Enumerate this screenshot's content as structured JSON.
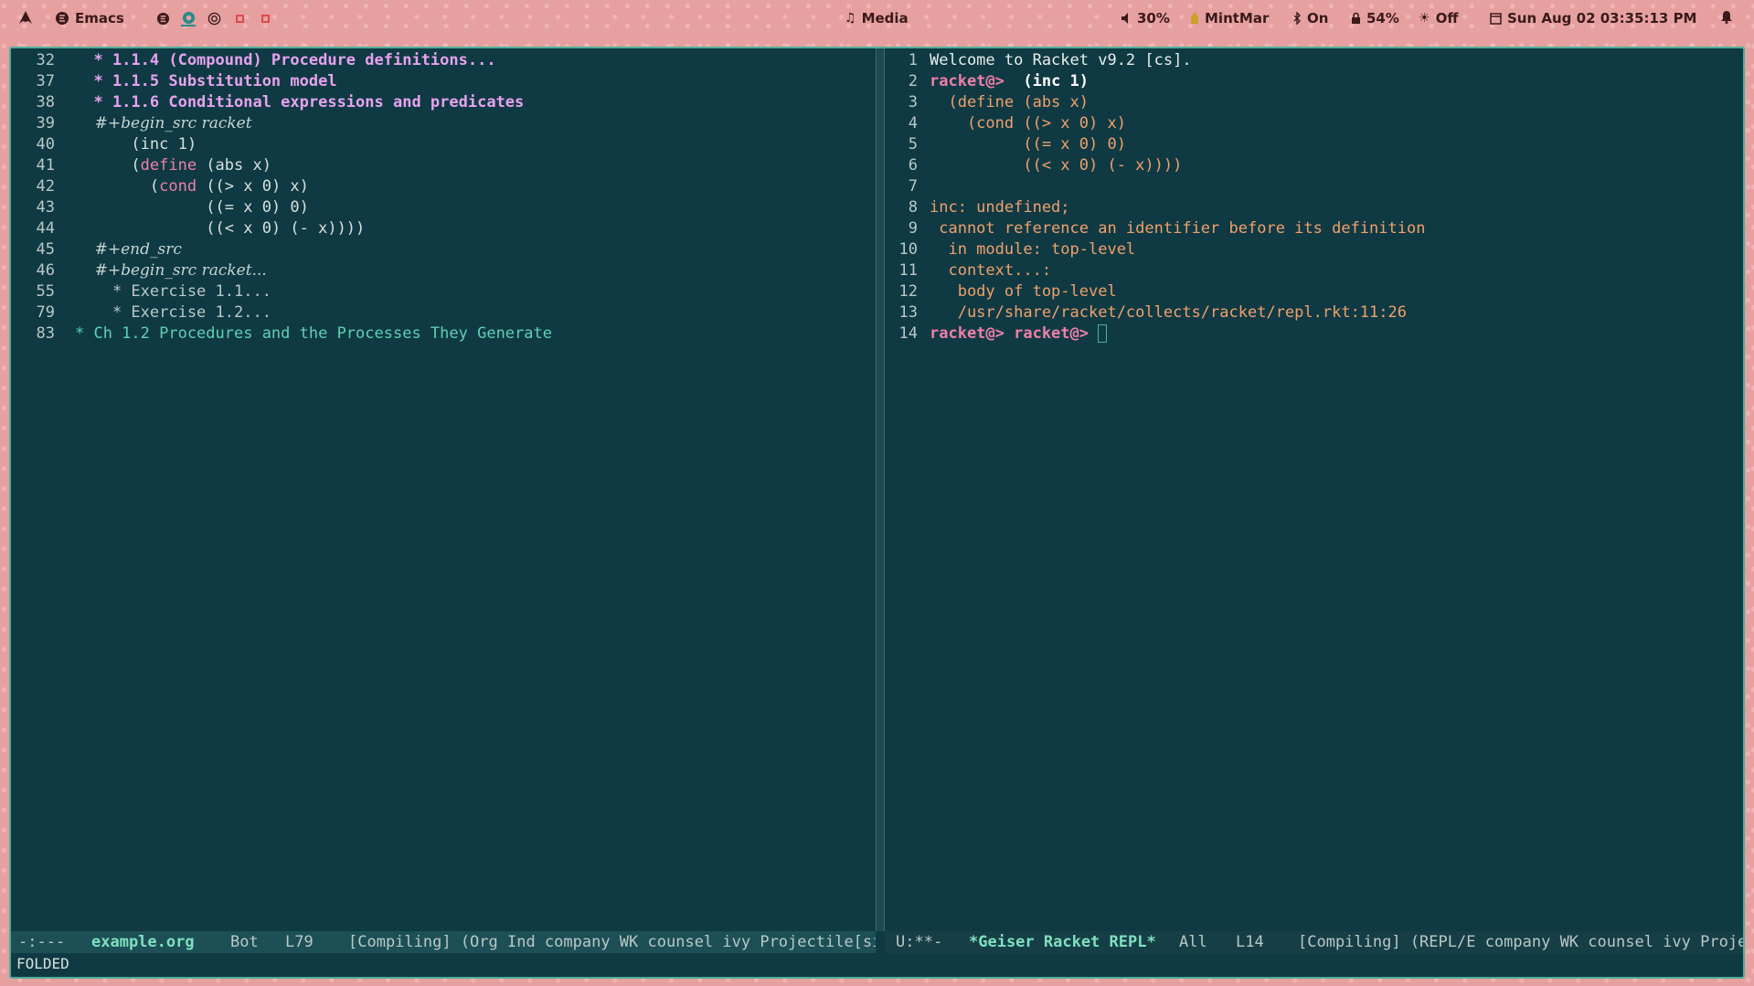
{
  "topbar": {
    "launcher_icon": "arch-icon",
    "app_icon": "emacs-icon",
    "app_label": "Emacs",
    "workspaces": [
      "emacs-ws-icon",
      "browser-ws-icon",
      "target-ws-icon",
      "empty-ws-icon",
      "empty-ws-icon"
    ],
    "media_label": "Media",
    "volume": "30%",
    "keyboard": "MintMar",
    "bluetooth": "On",
    "battery": "54%",
    "brightness": "Off",
    "datetime": "Sun Aug 02 03:35:13 PM"
  },
  "left_pane": {
    "lines": [
      {
        "num": "32",
        "text": "  * 1.1.4 (Compound) Procedure definitions...",
        "kind": "head"
      },
      {
        "num": "37",
        "text": "  * 1.1.5 Substitution model",
        "kind": "head"
      },
      {
        "num": "38",
        "text": "  * 1.1.6 Conditional expressions and predicates",
        "kind": "head"
      },
      {
        "num": "39",
        "text": "    #+begin_src racket",
        "kind": "meta"
      },
      {
        "num": "40",
        "text": "      (inc 1)",
        "kind": "code"
      },
      {
        "num": "41",
        "text": "      (define (abs x)",
        "kind": "define"
      },
      {
        "num": "42",
        "text": "        (cond ((> x 0) x)",
        "kind": "cond"
      },
      {
        "num": "43",
        "text": "              ((= x 0) 0)",
        "kind": "code"
      },
      {
        "num": "44",
        "text": "              ((< x 0) (- x))))",
        "kind": "code"
      },
      {
        "num": "45",
        "text": "    #+end_src",
        "kind": "meta"
      },
      {
        "num": "46",
        "text": "    #+begin_src racket...",
        "kind": "meta"
      },
      {
        "num": "55",
        "text": "    * Exercise 1.1...",
        "kind": "ex"
      },
      {
        "num": "79",
        "text": "    * Exercise 1.2...",
        "kind": "ex"
      },
      {
        "num": "83",
        "text": "* Ch 1.2 Procedures and the Processes They Generate",
        "kind": "ch"
      }
    ]
  },
  "right_pane": {
    "lines": [
      {
        "num": "1",
        "text": "Welcome to Racket v9.2 [cs]."
      },
      {
        "num": "2",
        "prompt": "racket@>",
        "text": "  (inc 1)"
      },
      {
        "num": "3",
        "text": "  (define (abs x)"
      },
      {
        "num": "4",
        "text": "    (cond ((> x 0) x)"
      },
      {
        "num": "5",
        "text": "          ((= x 0) 0)"
      },
      {
        "num": "6",
        "text": "          ((< x 0) (- x))))"
      },
      {
        "num": "7",
        "text": ""
      },
      {
        "num": "8",
        "text": "inc: undefined;"
      },
      {
        "num": "9",
        "text": " cannot reference an identifier before its definition"
      },
      {
        "num": "10",
        "text": "  in module: top-level"
      },
      {
        "num": "11",
        "text": "  context...:"
      },
      {
        "num": "12",
        "text": "   body of top-level"
      },
      {
        "num": "13",
        "text": "   /usr/share/racket/collects/racket/repl.rkt:11:26"
      },
      {
        "num": "14",
        "prompt": "racket@> racket@>",
        "text": ""
      }
    ]
  },
  "modeline_left": {
    "state": "-:---",
    "buffer": "example.org",
    "position": "Bot",
    "line": "L79",
    "modes": "[Compiling] (Org Ind company WK counsel ivy Projectile[sic"
  },
  "modeline_right": {
    "state": "U:**-",
    "buffer": "*Geiser Racket REPL*",
    "position": "All",
    "line": "L14",
    "modes": "[Compiling] (REPL/E company WK counsel ivy Project"
  },
  "minibuffer": "FOLDED"
}
